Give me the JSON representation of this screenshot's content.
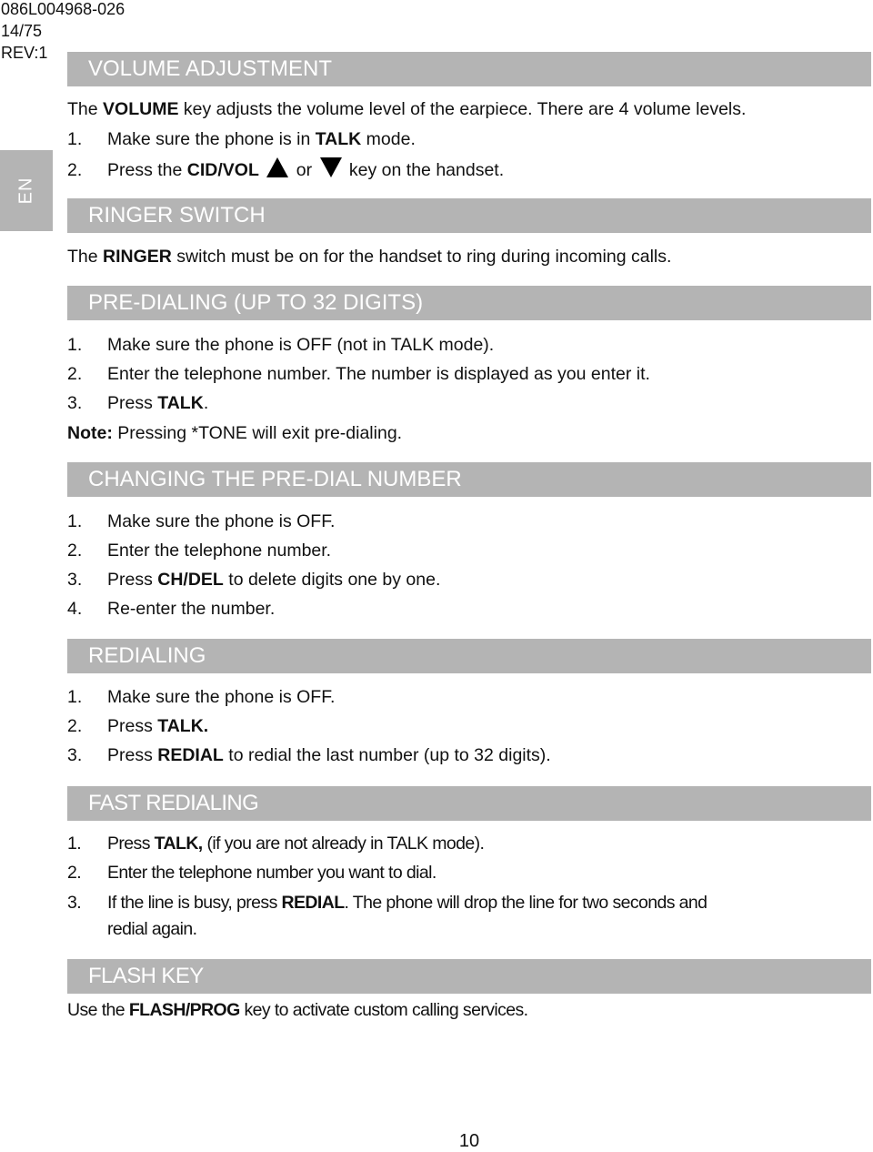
{
  "doc_meta": {
    "part_number": "086L004968-026",
    "sheet": "14/75",
    "revision": "REV:1"
  },
  "language_tab": "EN",
  "colors": {
    "header_bar": "#b4b4b4",
    "header_text": "#ffffff",
    "body_text": "#111111"
  },
  "sections": {
    "volume": {
      "title": "VOLUME ADJUSTMENT",
      "intro": {
        "pre": "The ",
        "bold": "VOLUME",
        "post": " key adjusts the volume level of the earpiece. There are 4 volume levels."
      },
      "steps": [
        {
          "num": "1.",
          "pre": "Make sure the phone is in ",
          "bold": "TALK",
          "post": " mode."
        },
        {
          "num": "2.",
          "pre": "Press the ",
          "bold": "CID/VOL",
          "mid": " or ",
          "post": " key on the handset."
        }
      ],
      "icons": {
        "up": "triangle-up-icon",
        "down": "triangle-down-icon"
      }
    },
    "ringer": {
      "title": "RINGER SWITCH",
      "intro": {
        "pre": "The ",
        "bold": "RINGER",
        "post": " switch must be on for the handset to ring during incoming calls."
      }
    },
    "predial": {
      "title": "PRE-DIALING (UP TO 32 DIGITS)",
      "steps": [
        {
          "num": "1.",
          "text": "Make sure the phone is OFF (not in TALK mode)."
        },
        {
          "num": "2.",
          "text": "Enter the telephone number. The number is displayed as you enter it."
        },
        {
          "num": "3.",
          "pre": "Press ",
          "bold": "TALK",
          "post": "."
        }
      ],
      "note": {
        "bold": "Note:",
        "text": " Pressing *TONE will exit pre-dialing."
      }
    },
    "change_predial": {
      "title": "CHANGING THE PRE-DIAL NUMBER",
      "steps": [
        {
          "num": "1.",
          "text": "Make sure the phone is OFF."
        },
        {
          "num": "2.",
          "text": "Enter the telephone number."
        },
        {
          "num": "3.",
          "pre": "Press ",
          "bold": "CH/DEL",
          "post": " to delete digits one by one."
        },
        {
          "num": "4.",
          "text": "Re-enter the number."
        }
      ]
    },
    "redialing": {
      "title": "REDIALING",
      "steps": [
        {
          "num": "1.",
          "text": "Make sure the phone is OFF."
        },
        {
          "num": "2.",
          "pre": "Press ",
          "bold": "TALK.",
          "post": ""
        },
        {
          "num": "3.",
          "pre": "Press ",
          "bold": "REDIAL",
          "post": " to redial the last number (up to 32 digits)."
        }
      ]
    },
    "fast_redialing": {
      "title": "FAST REDIALING",
      "steps": [
        {
          "num": "1.",
          "pre": "Press ",
          "bold": "TALK,",
          "post": " (if you are not already in TALK mode)."
        },
        {
          "num": "2.",
          "text": "Enter the telephone number you want to dial."
        },
        {
          "num": "3.",
          "pre": "If the line is busy, press ",
          "bold": "REDIAL",
          "post": ". The phone will drop the line for two seconds and",
          "cont": "redial again."
        }
      ]
    },
    "flash": {
      "title": "FLASH KEY",
      "intro": {
        "pre": "Use the ",
        "bold": "FLASH/PROG",
        "post": " key to activate custom calling services."
      }
    }
  },
  "page_number": "10"
}
